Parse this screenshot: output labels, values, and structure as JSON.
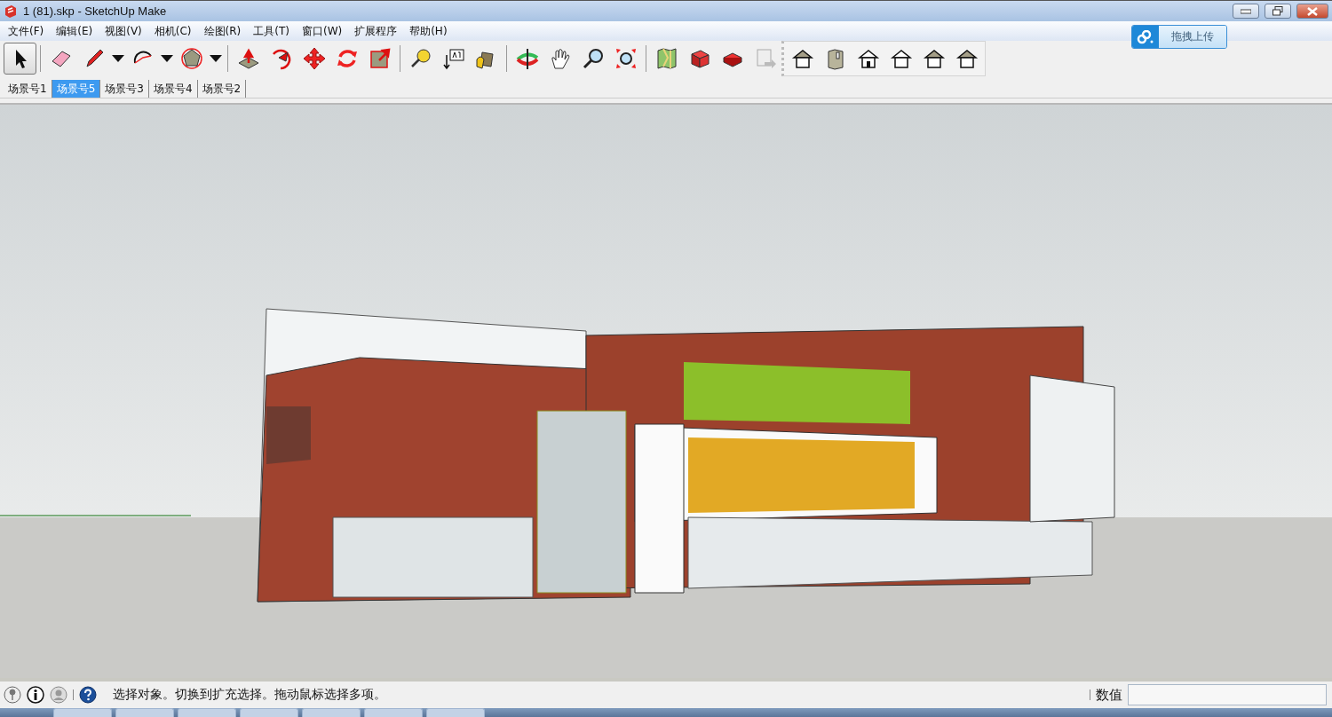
{
  "window": {
    "title": "1 (81).skp - SketchUp Make"
  },
  "menu": [
    "文件(F)",
    "编辑(E)",
    "视图(V)",
    "相机(C)",
    "绘图(R)",
    "工具(T)",
    "窗口(W)",
    "扩展程序",
    "帮助(H)"
  ],
  "upload_button": {
    "label": "拖拽上传"
  },
  "toolbar_groups": [
    [
      {
        "kind": "select",
        "selected": true
      }
    ],
    [
      {
        "kind": "eraser",
        "selected": false
      },
      {
        "kind": "pencil",
        "selected": false
      },
      {
        "kind": "dropdown",
        "selected": false
      },
      {
        "kind": "arc",
        "selected": false
      },
      {
        "kind": "dropdown",
        "selected": false
      },
      {
        "kind": "polygon",
        "selected": false
      },
      {
        "kind": "dropdown",
        "selected": false
      }
    ],
    [
      {
        "kind": "pushpull",
        "selected": false
      },
      {
        "kind": "followme",
        "selected": false
      },
      {
        "kind": "move",
        "selected": false
      },
      {
        "kind": "rotate",
        "selected": false
      },
      {
        "kind": "scale",
        "selected": false
      }
    ],
    [
      {
        "kind": "tape",
        "selected": false
      },
      {
        "kind": "text",
        "selected": false
      },
      {
        "kind": "paint",
        "selected": false
      }
    ],
    [
      {
        "kind": "orbit",
        "selected": false
      },
      {
        "kind": "pan",
        "selected": false
      },
      {
        "kind": "zoom",
        "selected": false
      },
      {
        "kind": "extents",
        "selected": false
      }
    ],
    [
      {
        "kind": "map",
        "selected": false
      },
      {
        "kind": "warehouse",
        "selected": false
      },
      {
        "kind": "share",
        "selected": false
      },
      {
        "kind": "export",
        "selected": false
      }
    ],
    [
      {
        "kind": "iso",
        "selected": false
      },
      {
        "kind": "top",
        "selected": false
      },
      {
        "kind": "front",
        "selected": false
      },
      {
        "kind": "right",
        "selected": false
      },
      {
        "kind": "back",
        "selected": false
      },
      {
        "kind": "left",
        "selected": false
      }
    ]
  ],
  "scene_tabs": [
    {
      "label": "场景号1",
      "selected": false
    },
    {
      "label": "场景号5",
      "selected": true
    },
    {
      "label": "场景号3",
      "selected": false
    },
    {
      "label": "场景号4",
      "selected": false
    },
    {
      "label": "场景号2",
      "selected": false
    }
  ],
  "viewport": {
    "kind": "picture"
  },
  "status_bar": {
    "message": "选择对象。切换到扩充选择。拖动鼠标选择多项。",
    "measurements_label": "数值"
  }
}
